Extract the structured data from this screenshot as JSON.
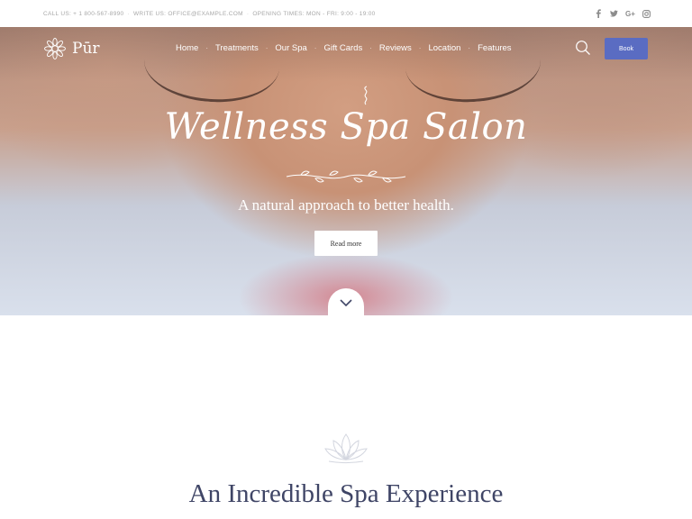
{
  "topbar": {
    "call": "CALL US: + 1 800-567-8990",
    "write": "WRITE US: OFFICE@EXAMPLE.COM",
    "hours": "OPENING TIMES: MON - FRI: 9:00 - 19:00",
    "separator": "·",
    "socials": [
      "facebook-icon",
      "twitter-icon",
      "google-plus-icon",
      "instagram-icon"
    ],
    "google_plus_label": "G+"
  },
  "header": {
    "logo_text": "Pūr",
    "nav": [
      "Home",
      "Treatments",
      "Our Spa",
      "Gift Cards",
      "Reviews",
      "Location",
      "Features"
    ],
    "nav_separator": "·",
    "book_label": "Book"
  },
  "hero": {
    "title": "Wellness Spa Salon",
    "subtitle": "A natural approach to better health.",
    "button_label": "Read more"
  },
  "section": {
    "title": "An Incredible Spa Experience"
  },
  "colors": {
    "accent": "#5a6cc2",
    "heading": "#3f4566",
    "topbar_text": "#a8a8a8"
  }
}
